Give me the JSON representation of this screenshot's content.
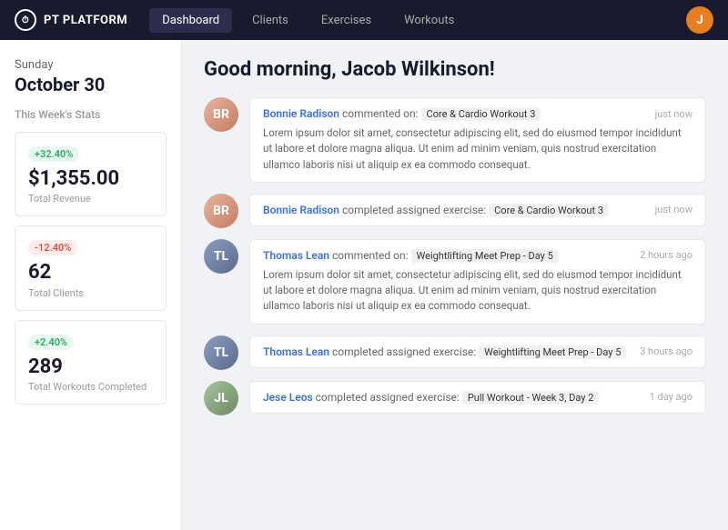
{
  "app": {
    "logo_icon": "⏱",
    "logo_text": "PT PLATFORM"
  },
  "nav": {
    "items": [
      {
        "label": "Dashboard",
        "active": true
      },
      {
        "label": "Clients",
        "active": false
      },
      {
        "label": "Exercises",
        "active": false
      },
      {
        "label": "Workouts",
        "active": false
      }
    ],
    "user_initial": "J"
  },
  "sidebar": {
    "day": "Sunday",
    "date": "October 30",
    "section_title": "This Week's Stats",
    "stats": [
      {
        "badge": "+32.40%",
        "badge_type": "up",
        "value": "$1,355.00",
        "label": "Total Revenue"
      },
      {
        "badge": "-12.40%",
        "badge_type": "down",
        "value": "62",
        "label": "Total Clients"
      },
      {
        "badge": "+2.40%",
        "badge_type": "up",
        "value": "289",
        "label": "Total Workouts Completed"
      }
    ]
  },
  "content": {
    "greeting": "Good morning, Jacob Wilkinson!",
    "feed": [
      {
        "id": "feed-1",
        "type": "comment-with-body",
        "avatar_class": "bonnie",
        "avatar_initials": "BR",
        "name": "Bonnie Radison",
        "action": "commented on:",
        "exercise": "Core & Cardio Workout 3",
        "time": "just now",
        "body": "Lorem ipsum dolor sit amet, consectetur adipiscing elit, sed do eiusmod tempor incididunt ut labore et dolore magna aliqua. Ut enim ad minim veniam, quis nostrud exercitation ullamco laboris nisi ut aliquip ex ea commodo consequat."
      },
      {
        "id": "feed-2",
        "type": "simple",
        "avatar_class": "bonnie",
        "avatar_initials": "BR",
        "name": "Bonnie Radison",
        "action": "completed assigned exercise:",
        "exercise": "Core & Cardio Workout 3",
        "time": "just now"
      },
      {
        "id": "feed-3",
        "type": "comment-with-body",
        "avatar_class": "thomas",
        "avatar_initials": "TL",
        "name": "Thomas Lean",
        "action": "commented on:",
        "exercise": "Weightlifting Meet Prep - Day 5",
        "time": "2 hours ago",
        "body": "Lorem ipsum dolor sit amet, consectetur adipiscing elit, sed do eiusmod tempor incididunt ut labore et dolore magna aliqua. Ut enim ad minim veniam, quis nostrud exercitation ullamco laboris nisi ut aliquip ex ea commodo consequat."
      },
      {
        "id": "feed-4",
        "type": "simple",
        "avatar_class": "thomas",
        "avatar_initials": "TL",
        "name": "Thomas Lean",
        "action": "completed assigned exercise:",
        "exercise": "Weightlifting Meet Prep - Day 5",
        "time": "3 hours ago"
      },
      {
        "id": "feed-5",
        "type": "simple",
        "avatar_class": "jese",
        "avatar_initials": "JL",
        "name": "Jese Leos",
        "action": "completed assigned exercise:",
        "exercise": "Pull Workout - Week 3, Day 2",
        "time": "1 day ago"
      }
    ]
  }
}
